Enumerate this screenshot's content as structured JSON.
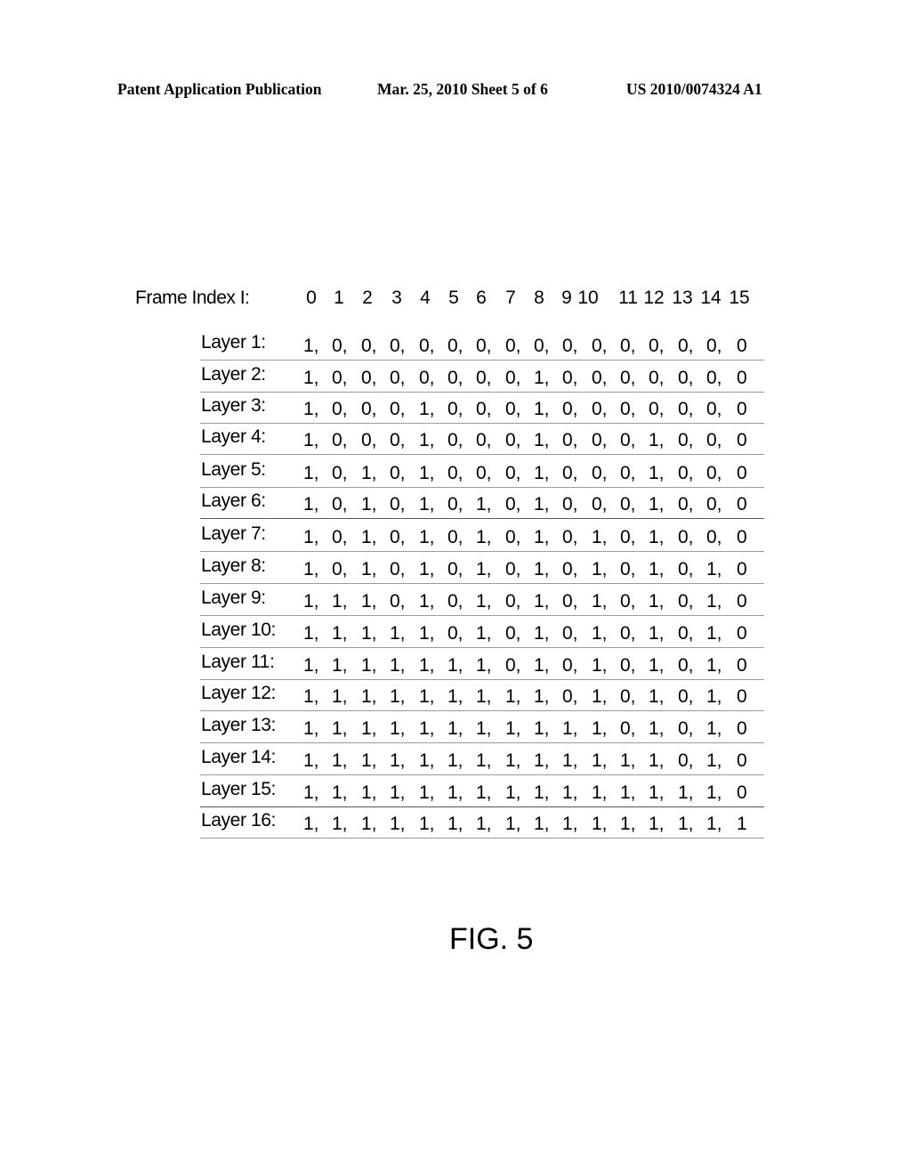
{
  "header": {
    "left": "Patent Application Publication",
    "middle": "Mar. 25, 2010  Sheet 5 of 6",
    "right": "US 2010/0074324 A1"
  },
  "table": {
    "frame_label": "Frame Index I:",
    "frame_indices": [
      "0",
      "1",
      "2",
      "3",
      "4",
      "5",
      "6",
      "7",
      "8",
      "9",
      "10",
      "11",
      "12",
      "13",
      "14",
      "15"
    ],
    "layers": [
      {
        "label": "Layer 1:",
        "values": [
          1,
          0,
          0,
          0,
          0,
          0,
          0,
          0,
          0,
          0,
          0,
          0,
          0,
          0,
          0,
          0
        ]
      },
      {
        "label": "Layer 2:",
        "values": [
          1,
          0,
          0,
          0,
          0,
          0,
          0,
          0,
          1,
          0,
          0,
          0,
          0,
          0,
          0,
          0
        ]
      },
      {
        "label": "Layer 3:",
        "values": [
          1,
          0,
          0,
          0,
          1,
          0,
          0,
          0,
          1,
          0,
          0,
          0,
          0,
          0,
          0,
          0
        ]
      },
      {
        "label": "Layer 4:",
        "values": [
          1,
          0,
          0,
          0,
          1,
          0,
          0,
          0,
          1,
          0,
          0,
          0,
          1,
          0,
          0,
          0
        ]
      },
      {
        "label": "Layer 5:",
        "values": [
          1,
          0,
          1,
          0,
          1,
          0,
          0,
          0,
          1,
          0,
          0,
          0,
          1,
          0,
          0,
          0
        ]
      },
      {
        "label": "Layer 6:",
        "values": [
          1,
          0,
          1,
          0,
          1,
          0,
          1,
          0,
          1,
          0,
          0,
          0,
          1,
          0,
          0,
          0
        ]
      },
      {
        "label": "Layer 7:",
        "values": [
          1,
          0,
          1,
          0,
          1,
          0,
          1,
          0,
          1,
          0,
          1,
          0,
          1,
          0,
          0,
          0
        ]
      },
      {
        "label": "Layer 8:",
        "values": [
          1,
          0,
          1,
          0,
          1,
          0,
          1,
          0,
          1,
          0,
          1,
          0,
          1,
          0,
          1,
          0
        ]
      },
      {
        "label": "Layer 9:",
        "values": [
          1,
          1,
          1,
          0,
          1,
          0,
          1,
          0,
          1,
          0,
          1,
          0,
          1,
          0,
          1,
          0
        ]
      },
      {
        "label": "Layer 10:",
        "values": [
          1,
          1,
          1,
          1,
          1,
          0,
          1,
          0,
          1,
          0,
          1,
          0,
          1,
          0,
          1,
          0
        ]
      },
      {
        "label": "Layer 11:",
        "values": [
          1,
          1,
          1,
          1,
          1,
          1,
          1,
          0,
          1,
          0,
          1,
          0,
          1,
          0,
          1,
          0
        ]
      },
      {
        "label": "Layer 12:",
        "values": [
          1,
          1,
          1,
          1,
          1,
          1,
          1,
          1,
          1,
          0,
          1,
          0,
          1,
          0,
          1,
          0
        ]
      },
      {
        "label": "Layer 13:",
        "values": [
          1,
          1,
          1,
          1,
          1,
          1,
          1,
          1,
          1,
          1,
          1,
          0,
          1,
          0,
          1,
          0
        ]
      },
      {
        "label": "Layer 14:",
        "values": [
          1,
          1,
          1,
          1,
          1,
          1,
          1,
          1,
          1,
          1,
          1,
          1,
          1,
          0,
          1,
          0
        ]
      },
      {
        "label": "Layer 15:",
        "values": [
          1,
          1,
          1,
          1,
          1,
          1,
          1,
          1,
          1,
          1,
          1,
          1,
          1,
          1,
          1,
          0
        ]
      },
      {
        "label": "Layer 16:",
        "values": [
          1,
          1,
          1,
          1,
          1,
          1,
          1,
          1,
          1,
          1,
          1,
          1,
          1,
          1,
          1,
          1
        ]
      }
    ]
  },
  "figure_label": "FIG. 5"
}
